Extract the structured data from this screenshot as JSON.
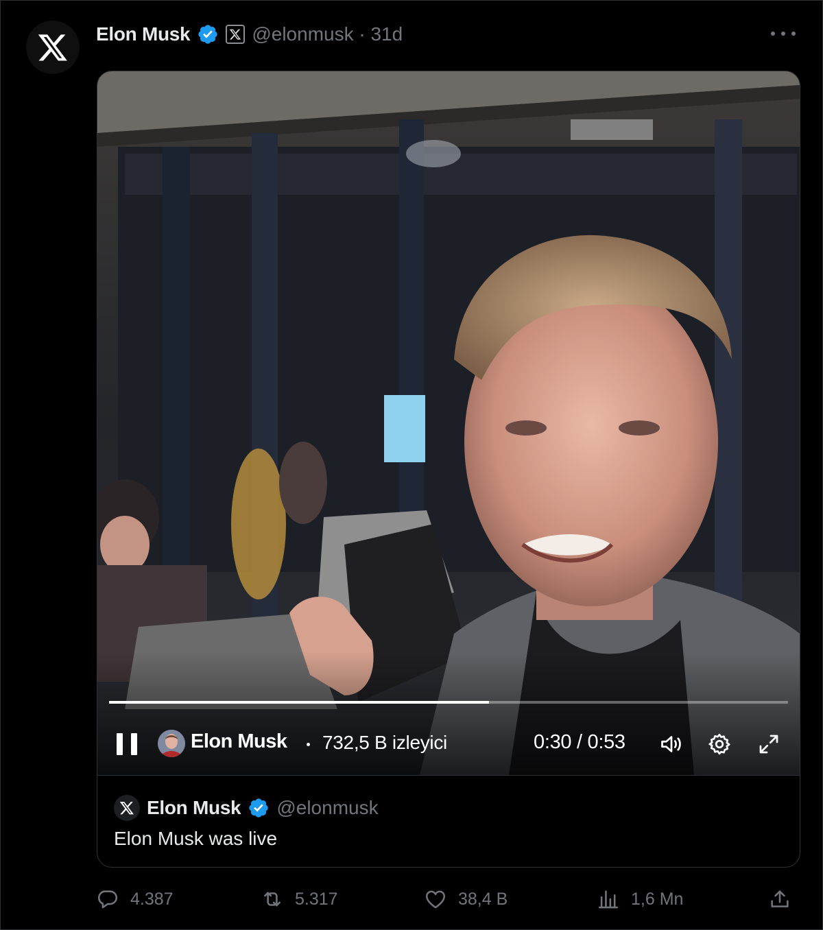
{
  "tweet": {
    "author_name": "Elon Musk",
    "handle_time": "@elonmusk · 31d",
    "more_label": "More"
  },
  "video": {
    "progress_fraction": 0.56,
    "live_author": "Elon Musk",
    "viewers": "732,5 B izleyici",
    "time": "0:30 / 0:53"
  },
  "quote": {
    "author_name": "Elon Musk",
    "handle": "@elonmusk",
    "text": "Elon Musk was live"
  },
  "actions": {
    "replies": "4.387",
    "reposts": "5.317",
    "likes": "38,4 B",
    "views": "1,6 Mn"
  },
  "colors": {
    "background": "#000000",
    "text_primary": "#e7e9ea",
    "text_secondary": "#71767b",
    "verified": "#1d9bf0",
    "border": "#2f3336"
  },
  "icons": {
    "avatar": "x-logo-icon",
    "verified": "verified-badge-icon",
    "affiliate": "x-affiliate-badge-icon",
    "more": "more-horizontal-icon",
    "pause": "pause-icon",
    "volume": "volume-icon",
    "settings": "gear-icon",
    "fullscreen": "fullscreen-icon",
    "reply": "reply-icon",
    "repost": "repost-icon",
    "like": "heart-icon",
    "views": "views-chart-icon",
    "share": "share-icon"
  }
}
